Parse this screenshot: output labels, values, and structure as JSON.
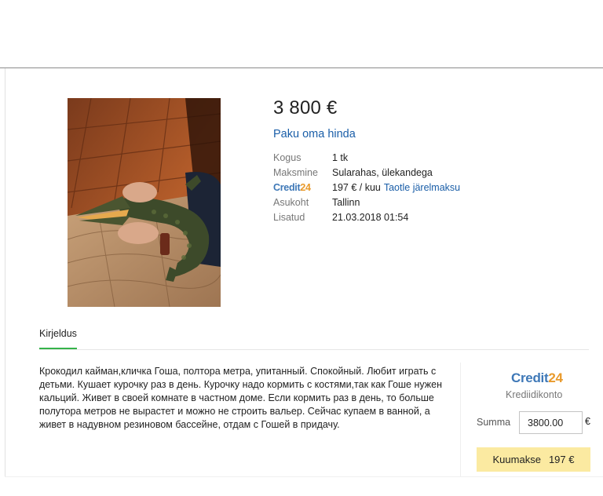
{
  "listing": {
    "price": "3 800 €",
    "offer_link": "Paku oma hinda",
    "details": [
      {
        "label": "Kogus",
        "value": "1 tk"
      },
      {
        "label": "Maksmine",
        "value": "Sularahas, ülekandega"
      },
      {
        "label_logo": {
          "main": "Credit",
          "num": "24"
        },
        "value": "197 € / kuu",
        "link": "Taotle järelmaksu"
      },
      {
        "label": "Asukoht",
        "value": "Tallinn"
      },
      {
        "label": "Lisatud",
        "value": "21.03.2018 01:54"
      }
    ]
  },
  "tabs": {
    "description_tab": "Kirjeldus"
  },
  "description": "Крокодил кайман,кличка Гоша, полтора метра, упитанный. Спокойный. Любит играть с детьми. Кушает  курочку раз в день. Курочку надо кормить с костями,так как Гоше нужен кальций. Живет в своей комнате в частном доме. Если кормить раз в день, то больше полутора метров не вырастет и можно не строить вальер. Сейчас купаем в ванной, а живет в надувном резиновом бассейне, отдам с Гошей в придачу.",
  "credit_panel": {
    "logo": {
      "main": "Credit",
      "num": "24"
    },
    "subtitle": "Krediidikonto",
    "sum_label": "Summa",
    "sum_value": "3800.00",
    "currency": "€",
    "button_label": "Kuumakse",
    "button_amount": "197 €"
  },
  "colors": {
    "link": "#1a5ea8",
    "tab_accent": "#35b34a",
    "pay_button": "#fbeaa1",
    "credit_blue": "#3e78b7",
    "credit_orange": "#e99a2b"
  },
  "icons": {
    "photo": "crocodile-photo"
  }
}
